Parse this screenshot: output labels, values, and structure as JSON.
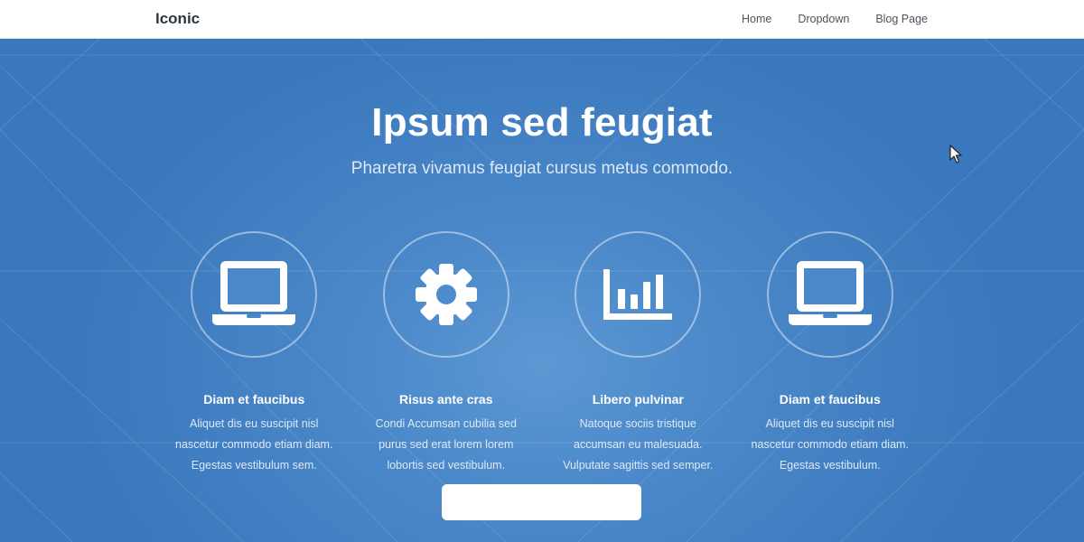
{
  "navbar": {
    "brand": "Iconic",
    "links": [
      {
        "label": "Home"
      },
      {
        "label": "Dropdown"
      },
      {
        "label": "Blog Page"
      }
    ]
  },
  "hero": {
    "title": "Ipsum sed feugiat",
    "subtitle": "Pharetra vivamus feugiat cursus metus commodo.",
    "cta_label": ""
  },
  "features": [
    {
      "icon": "laptop-icon",
      "title": "Diam et faucibus",
      "lines": [
        "Aliquet dis eu suscipit nisl",
        "nascetur commodo etiam diam.",
        "Egestas vestibulum sem."
      ]
    },
    {
      "icon": "gear-icon",
      "title": "Risus ante cras",
      "lines": [
        "Condi Accumsan cubilia sed",
        "purus sed erat lorem lorem",
        "lobortis sed vestibulum."
      ]
    },
    {
      "icon": "bar-chart-icon",
      "title": "Libero pulvinar",
      "lines": [
        "Natoque sociis tristique",
        "accumsan eu malesuada.",
        "Vulputate sagittis sed semper."
      ]
    },
    {
      "icon": "laptop-icon",
      "title": "Diam et faucibus",
      "lines": [
        "Aliquet dis eu suscipit nisl",
        "nascetur commodo etiam diam.",
        "Egestas vestibulum."
      ]
    }
  ],
  "colors": {
    "nav_background": "#ffffff",
    "hero_background": "#3f7fc3",
    "accent_text": "#ffffff"
  }
}
